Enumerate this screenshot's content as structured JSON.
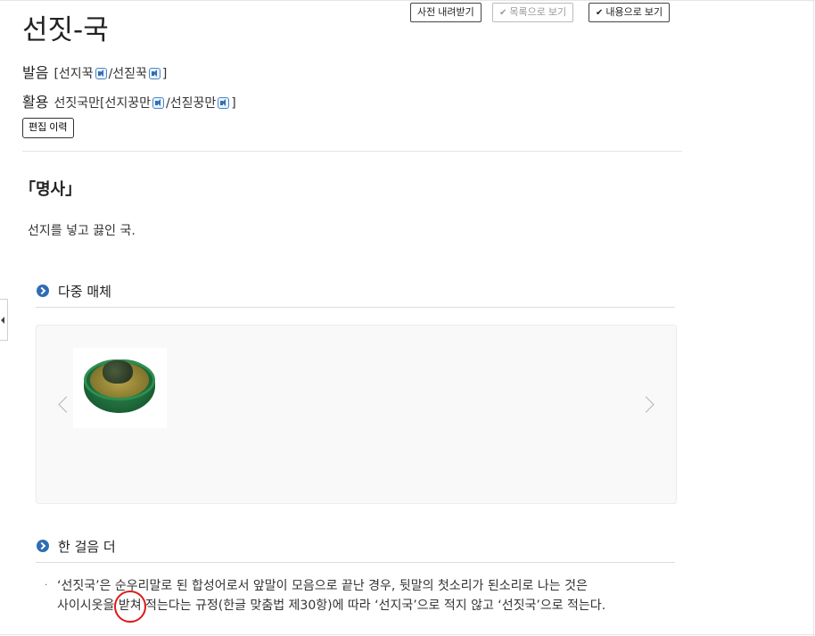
{
  "toolbar": {
    "download_label": "사전 내려받기",
    "list_view_label": "목록으로 보기",
    "content_view_label": "내용으로 보기"
  },
  "entry": {
    "headword": "선짓-국",
    "pronunciation": {
      "label": "발음",
      "open": "[",
      "form1": "선지꾹",
      "sep": "/",
      "form2": "선짇꾹",
      "close": "]"
    },
    "conjugation": {
      "label": "활용",
      "base": "선짓국만",
      "open": "[",
      "form1": "선지꿍만",
      "sep": "/",
      "form2": "선짇꿍만",
      "close": "]"
    },
    "history_button_label": "편집 이력",
    "part_of_speech": "「명사」",
    "definition": "선지를 넣고 끓인 국."
  },
  "media_section": {
    "title": "다중 매체",
    "icon": "chevron-circle-icon",
    "image_icon": "soup-bowl-image"
  },
  "more_section": {
    "title": "한 걸음 더",
    "bullet": "·",
    "line1": "‘선짓국’은 순우리말로 된 합성어로서 앞말이 모음으로 끝난 경우, 뒷말의 첫소리가 된소리로 나는 것은",
    "line2": "사이시옷을 받쳐 적는다는 규정(한글 맞춤법 제30항)에 따라 ‘선지국’으로 적지 않고 ‘선짓국’으로 적는다."
  },
  "colors": {
    "accent_blue": "#2e6db4",
    "annotation_red": "#e01818"
  }
}
